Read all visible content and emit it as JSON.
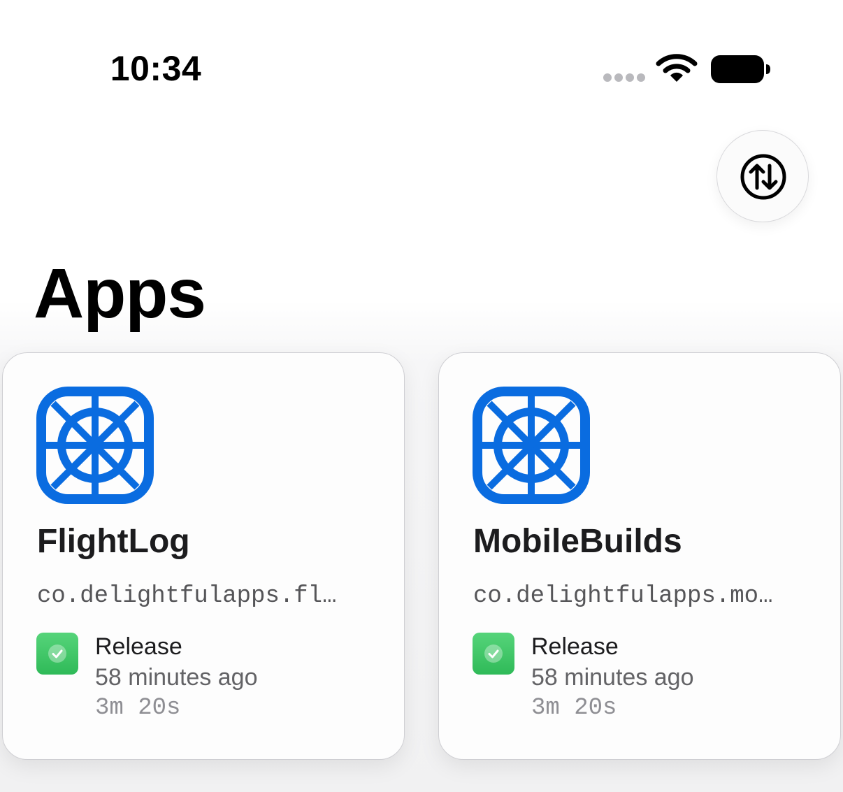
{
  "status_bar": {
    "time": "10:34",
    "icons": [
      "signal-dots-icon",
      "wifi-icon",
      "battery-icon"
    ]
  },
  "toolbar": {
    "sort_icon": "arrow-up-arrow-down-circle-icon"
  },
  "page": {
    "title": "Apps"
  },
  "colors": {
    "app_icon_blue": "#0a6ce0",
    "status_success": "#34c759",
    "text_primary": "#1c1c1e",
    "text_secondary": "#636366",
    "text_tertiary": "#8e8e93"
  },
  "apps": [
    {
      "name": "FlightLog",
      "bundle_id": "co.delightfulapps.fl…",
      "icon": "app-grid-icon",
      "latest_build": {
        "status": "success",
        "status_icon": "checkmark-icon",
        "workflow": "Release",
        "time_ago": "58 minutes ago",
        "duration": "3m 20s"
      }
    },
    {
      "name": "MobileBuilds",
      "bundle_id": "co.delightfulapps.mo…",
      "icon": "app-grid-icon",
      "latest_build": {
        "status": "success",
        "status_icon": "checkmark-icon",
        "workflow": "Release",
        "time_ago": "58 minutes ago",
        "duration": "3m 20s"
      }
    }
  ]
}
